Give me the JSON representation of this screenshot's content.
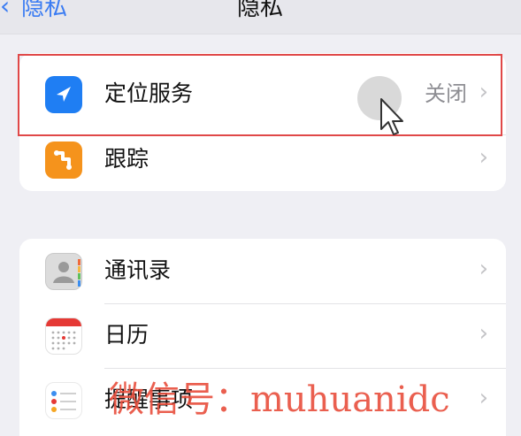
{
  "nav": {
    "back_label": "隐私",
    "title": "隐私"
  },
  "group1": [
    {
      "label": "定位服务",
      "value": "关闭",
      "icon": "location-arrow-icon"
    },
    {
      "label": "跟踪",
      "value": "",
      "icon": "tracking-icon"
    }
  ],
  "group2": [
    {
      "label": "通讯录",
      "icon": "contacts-icon"
    },
    {
      "label": "日历",
      "icon": "calendar-icon"
    },
    {
      "label": "提醒事项",
      "icon": "reminders-icon"
    }
  ],
  "chevron": "›",
  "watermark": "微信号：muhuanidc",
  "colors": {
    "accent": "#1f7ef3",
    "highlight": "#e04848",
    "watermark": "#e84e3c"
  }
}
